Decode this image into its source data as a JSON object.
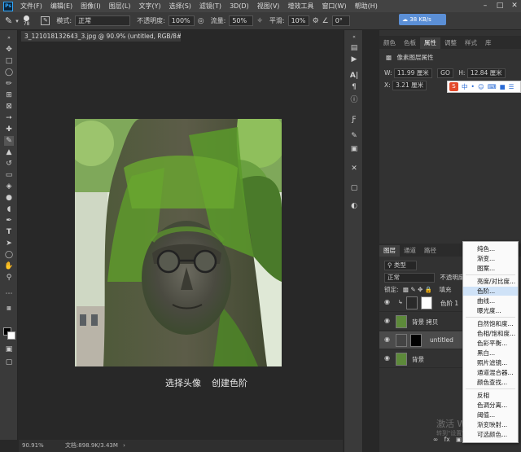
{
  "menubar": {
    "logo": "Ps",
    "items": [
      "文件(F)",
      "编辑(E)",
      "图像(I)",
      "图层(L)",
      "文字(Y)",
      "选择(S)",
      "滤镜(T)",
      "3D(D)",
      "视图(V)",
      "增效工具",
      "窗口(W)",
      "帮助(H)"
    ]
  },
  "options": {
    "brush_size": "78",
    "mode_label": "模式:",
    "mode_value": "正常",
    "opacity_label": "不透明度:",
    "opacity_value": "100%",
    "flow_label": "流量:",
    "flow_value": "50%",
    "smooth_label": "平滑:",
    "smooth_value": "10%",
    "angle_value": "0°",
    "net_speed": "38 KB/s"
  },
  "document": {
    "tab_title": "3_121018132643_3.jpg @ 90.9% (untitled, RGB/8#) *",
    "caption_left": "选择头像",
    "caption_right": "创建色阶",
    "zoom": "90.91%",
    "doc_info": "文档:898.9K/3.43M"
  },
  "properties": {
    "tabs": [
      "颜色",
      "色板",
      "属性",
      "调整",
      "样式",
      "库"
    ],
    "active_tab": "属性",
    "header": "像素图层属性",
    "w_label": "W:",
    "w_value": "11.99 厘米",
    "h_label": "H:",
    "h_value": "12.84 厘米",
    "x_label": "X:",
    "x_value": "3.21 厘米",
    "y_label": "Y:",
    "link_icon": "GO"
  },
  "ime": {
    "logo": "S",
    "items": [
      "中",
      "•",
      "☺",
      "⌨",
      "■",
      "☰"
    ]
  },
  "layers": {
    "tabs": [
      "图层",
      "通道",
      "路径"
    ],
    "filter_label": "类型",
    "blend_value": "正常",
    "opacity_label": "不透明度:",
    "lock_label": "锁定:",
    "fill_label": "填充",
    "rows": [
      {
        "name": "色阶 1"
      },
      {
        "name": "背景 拷贝"
      },
      {
        "name": "untitled"
      },
      {
        "name": "背景"
      }
    ]
  },
  "adjust_menu": {
    "items": [
      "纯色...",
      "渐变...",
      "图案...",
      "亮度/对比度...",
      "色阶...",
      "曲线...",
      "曝光度...",
      "自然饱和度...",
      "色相/饱和度...",
      "色彩平衡...",
      "黑白...",
      "照片滤镜...",
      "通道混合器...",
      "颜色查找...",
      "反相",
      "色调分离...",
      "阈值...",
      "渐变映射...",
      "可选颜色..."
    ],
    "highlighted": "色阶..."
  },
  "watermark": {
    "line1": "激活 Windows",
    "line2": "转到\"设置\"以激活 Windows。"
  },
  "colors": {
    "accent": "#31a8ff",
    "menu_highlight": "#cfe2f7",
    "bg": "#282828",
    "panel": "#323232"
  }
}
